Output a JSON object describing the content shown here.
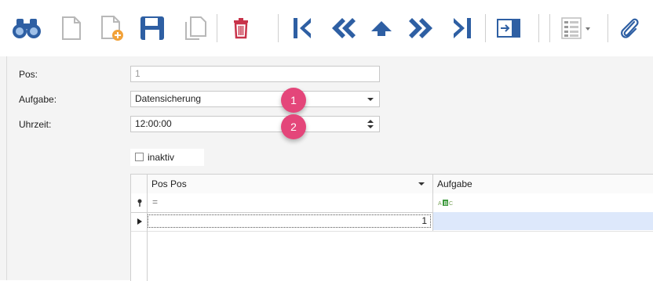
{
  "toolbar": {
    "buttons": [
      {
        "icon": "binoculars-icon",
        "color": "#2e5fa3"
      },
      {
        "icon": "new-document-icon",
        "color": "#b8b8b8"
      },
      {
        "icon": "new-document-add-icon",
        "color": "#f2a23a"
      },
      {
        "icon": "save-icon",
        "color": "#2e5fa3"
      },
      {
        "icon": "copy-document-icon",
        "color": "#b8b8b8"
      },
      {
        "icon": "delete-icon",
        "color": "#c8334a"
      },
      {
        "icon": "first-record-icon",
        "color": "#2e5fa3"
      },
      {
        "icon": "previous-page-icon",
        "color": "#2e5fa3"
      },
      {
        "icon": "up-arrow-icon",
        "color": "#2e5fa3"
      },
      {
        "icon": "next-page-icon",
        "color": "#2e5fa3"
      },
      {
        "icon": "last-record-icon",
        "color": "#2e5fa3"
      },
      {
        "icon": "exit-icon",
        "color": "#2e5fa3"
      },
      {
        "icon": "column-chooser-icon",
        "color": "#9a9a9a"
      },
      {
        "icon": "attachment-icon",
        "color": "#2e5fa3"
      }
    ]
  },
  "form": {
    "pos": {
      "label": "Pos:",
      "value": "1"
    },
    "aufgabe": {
      "label": "Aufgabe:",
      "value": "Datensicherung"
    },
    "uhrzeit": {
      "label": "Uhrzeit:",
      "value": "12:00:00"
    },
    "inaktiv": {
      "label": "inaktiv",
      "checked": false
    }
  },
  "badges": [
    "1",
    "2"
  ],
  "badge_color": "#e4467a",
  "grid": {
    "columns": [
      "Pos Pos",
      "Aufgabe"
    ],
    "filter_row": {
      "pos_operator": "=",
      "aufgabe_icon": "text-filter-icon"
    },
    "rows": [
      {
        "pos": "1",
        "aufgabe": ""
      }
    ]
  }
}
